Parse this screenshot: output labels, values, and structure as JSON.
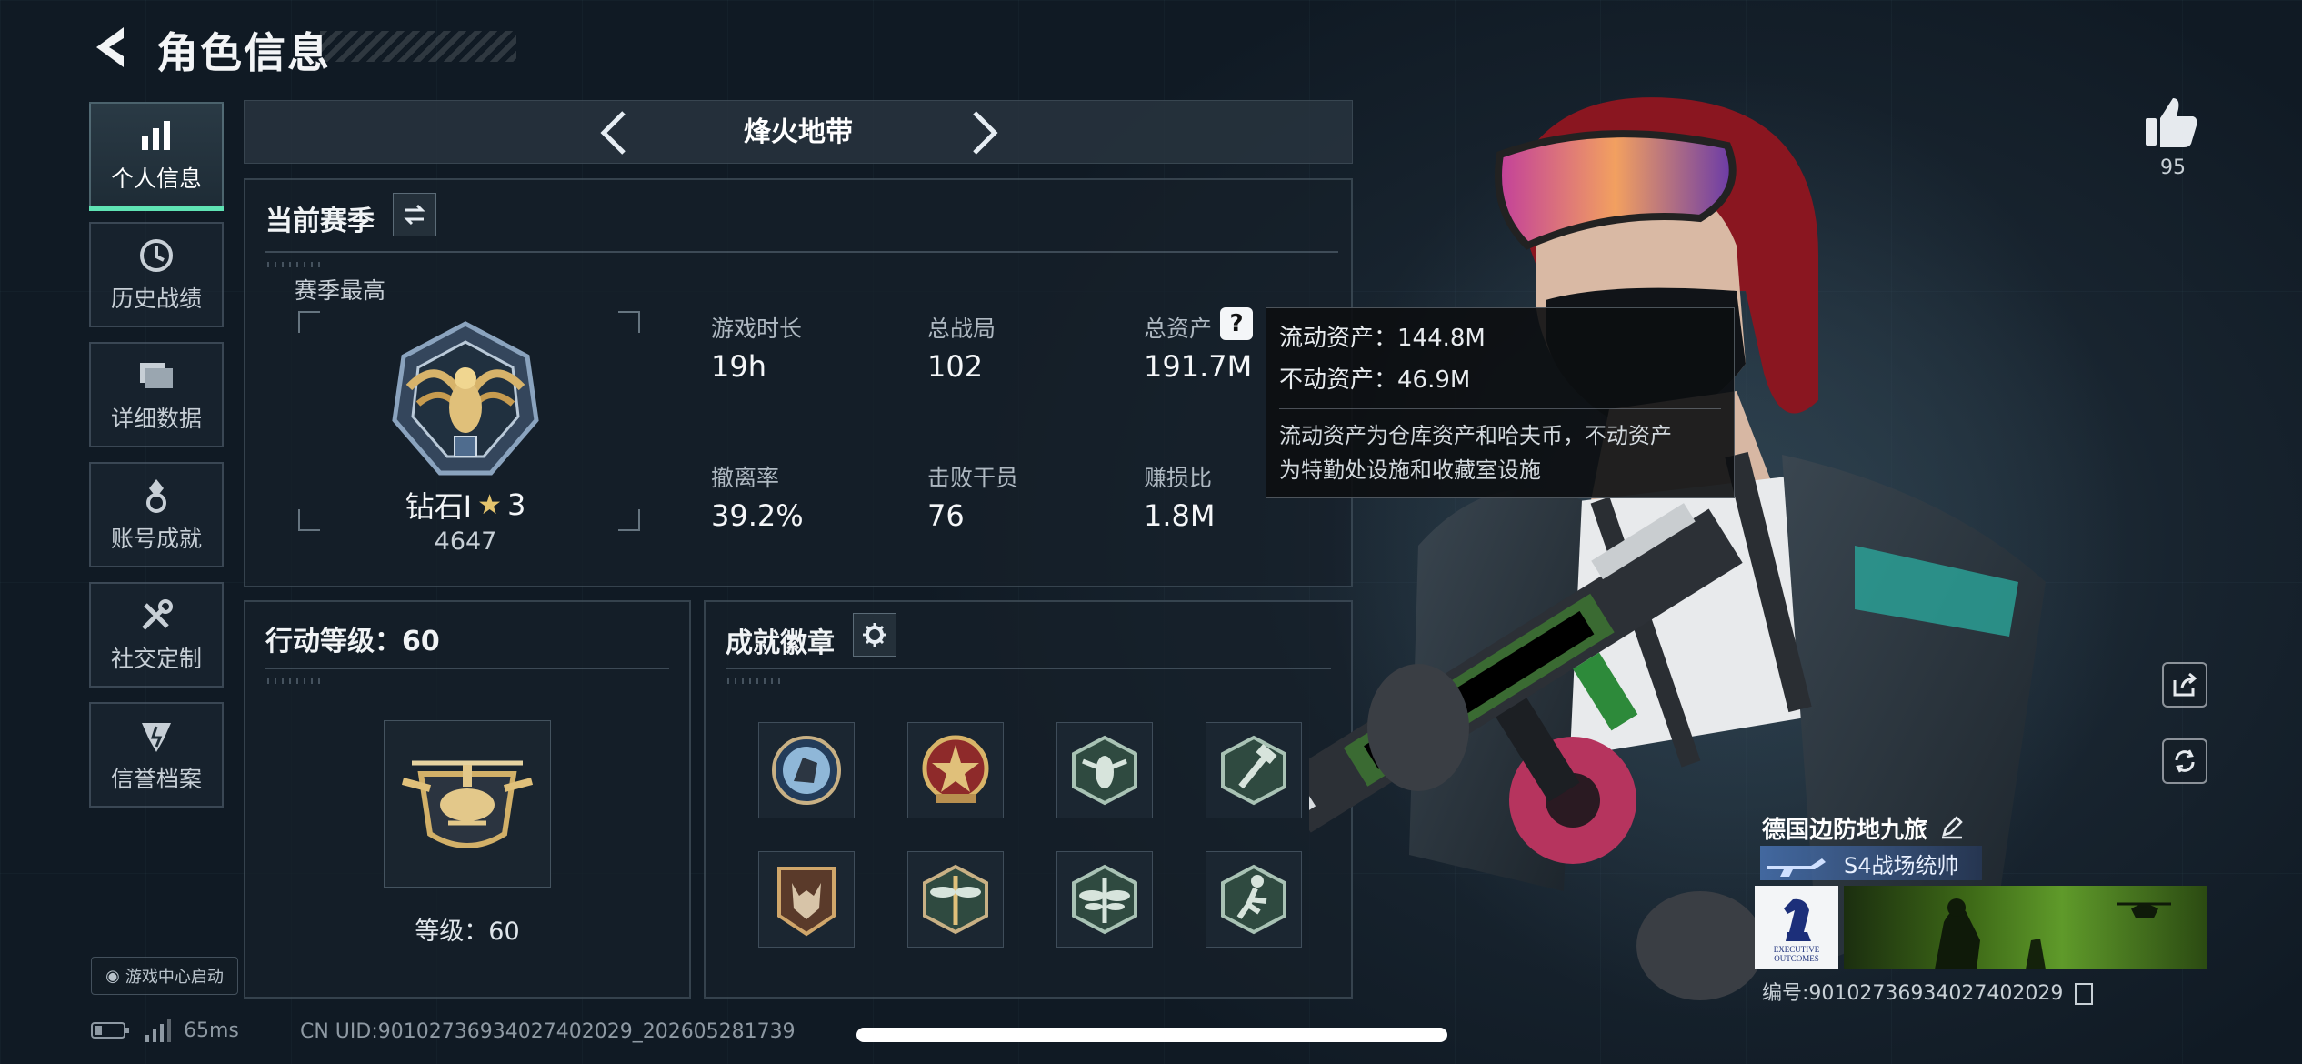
{
  "header": {
    "title": "角色信息"
  },
  "sidebar": {
    "items": [
      {
        "label": "个人信息",
        "icon": "bar-chart-icon",
        "active": true
      },
      {
        "label": "历史战绩",
        "icon": "clock-icon",
        "active": false
      },
      {
        "label": "详细数据",
        "icon": "folders-icon",
        "active": false
      },
      {
        "label": "账号成就",
        "icon": "medal-icon",
        "active": false
      },
      {
        "label": "社交定制",
        "icon": "tools-icon",
        "active": false
      },
      {
        "label": "信誉档案",
        "icon": "shield-icon",
        "active": false
      }
    ],
    "launch_label": "游戏中心启动"
  },
  "mode": {
    "title": "烽火地带"
  },
  "season": {
    "title": "当前赛季",
    "best_label": "赛季最高",
    "rank_name": "钻石I",
    "rank_stars": "3",
    "rank_score": "4647",
    "stats": [
      {
        "label": "游戏时长",
        "value": "19h"
      },
      {
        "label": "总战局",
        "value": "102"
      },
      {
        "label": "总资产",
        "value": "191.7M"
      },
      {
        "label": "撤离率",
        "value": "39.2%"
      },
      {
        "label": "击败干员",
        "value": "76"
      },
      {
        "label": "赚损比",
        "value": "1.8M"
      }
    ]
  },
  "tooltip": {
    "liquid": "流动资产：144.8M",
    "fixed": "不动资产：46.9M",
    "desc_line1": "流动资产为仓库资产和哈夫币，不动资产",
    "desc_line2": "为特勤处设施和收藏室设施"
  },
  "action_level": {
    "title": "行动等级：60",
    "level_label": "等级：60"
  },
  "achievements": {
    "title": "成就徽章",
    "badges": [
      "hound-badge",
      "star-medal-badge",
      "wasp-badge",
      "hammer-badge",
      "fox-badge",
      "dragonfly-badge",
      "dragonfly-badge-2",
      "runner-badge"
    ]
  },
  "profile": {
    "like_count": "95",
    "guild_name": "德国边防地九旅",
    "rank_title": "S4战场统帅",
    "card_logo_text": "EXECUTIVE OUTCOMES",
    "card_uid": "编号:9010273693402740202​9"
  },
  "footer": {
    "ping": "65ms",
    "uid": "CN UID:90102736934027402029_202605281739"
  },
  "colors": {
    "accent": "#5fe3b4",
    "background": "#101a24",
    "tooltip_bg": "#0c0e11"
  }
}
